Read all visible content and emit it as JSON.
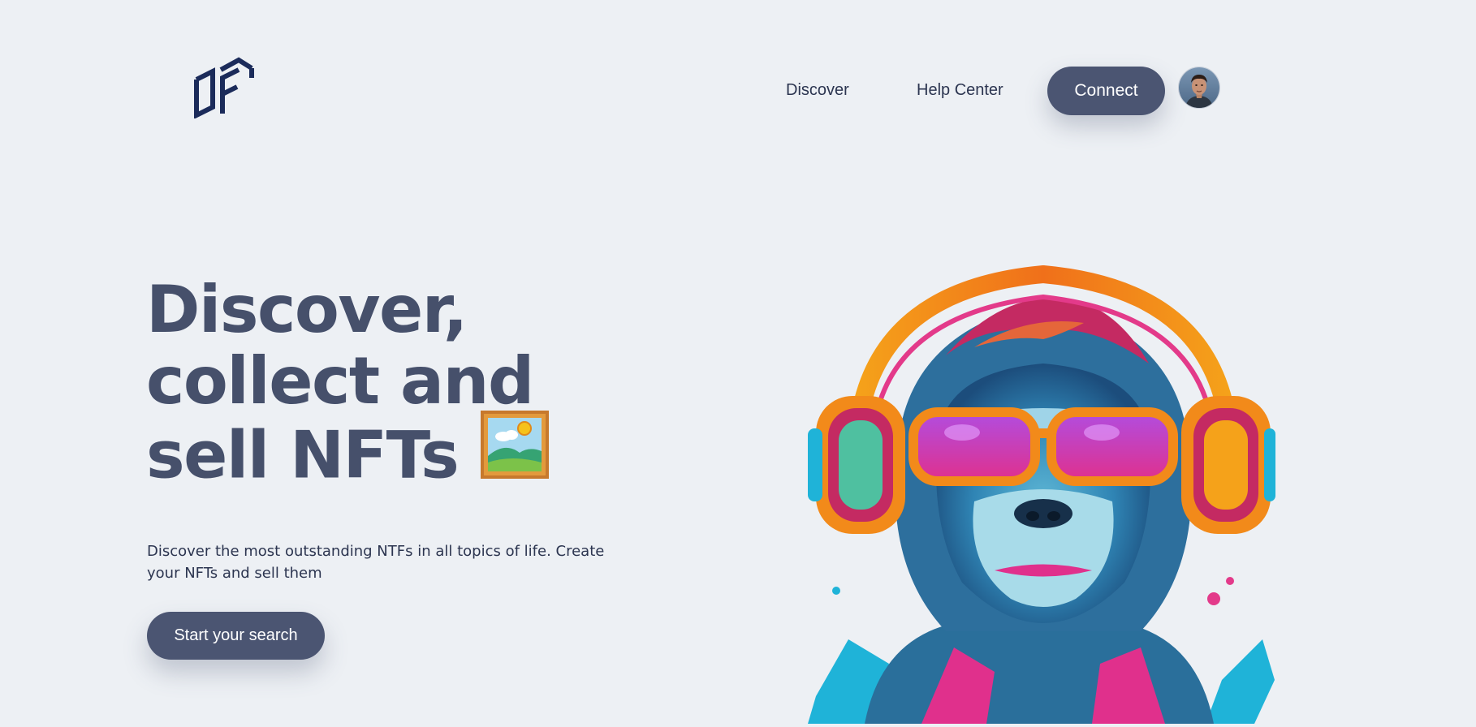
{
  "brand": {
    "logo_icon": "df-cube-logo-icon",
    "color": "#1b2b5a"
  },
  "nav": {
    "links": [
      {
        "label": "Discover"
      },
      {
        "label": "Help Center"
      }
    ],
    "connect_label": "Connect",
    "avatar_icon": "user-avatar"
  },
  "hero": {
    "title_lines": [
      "Discover,",
      "collect and",
      "sell NFTs"
    ],
    "title_icon": "framed-picture-icon",
    "description": "Discover the most outstanding NTFs in all topics of life. Create your NFTs and sell them",
    "cta_label": "Start your search",
    "image_icon": "gorilla-headphones-nft-illustration"
  },
  "colors": {
    "background": "#edf0f4",
    "primary": "#4b5572",
    "heading": "#46506b",
    "text": "#2c3550"
  }
}
